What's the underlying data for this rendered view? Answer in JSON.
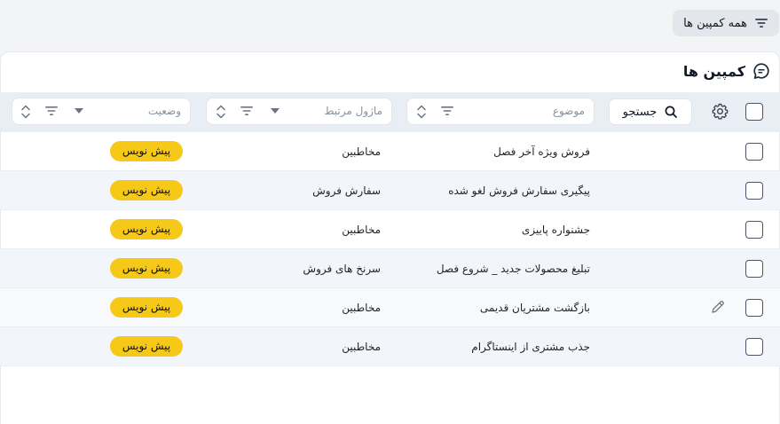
{
  "top": {
    "filter_label": "همه کمپین ها",
    "filter_icon": "filter-lines-icon"
  },
  "panel": {
    "title": "کمپین ها",
    "title_icon": "chat-bubble-icon"
  },
  "toolbar": {
    "settings_icon": "gear-icon",
    "search_label": "جستجو",
    "search_icon": "search-icon"
  },
  "columns": {
    "subject": {
      "label": "موضوع"
    },
    "module": {
      "label": "ماژول مرتبط"
    },
    "status": {
      "label": "وضعیت"
    }
  },
  "rows": [
    {
      "subject": "فروش ویژه آخر فصل",
      "module": "مخاطبین",
      "status": "پیش نویس"
    },
    {
      "subject": "پیگیری سفارش فروش لغو شده",
      "module": "سفارش فروش",
      "status": "پیش نویس"
    },
    {
      "subject": "جشنواره پاییزی",
      "module": "مخاطبین",
      "status": "پیش نویس"
    },
    {
      "subject": "تبلیغ محصولات جدید _ شروع فصل",
      "module": "سرنخ های فروش",
      "status": "پیش نویس"
    },
    {
      "subject": "بازگشت مشتریان قدیمی",
      "module": "مخاطبین",
      "status": "پیش نویس"
    },
    {
      "subject": "جذب مشتری از اینستاگرام",
      "module": "مخاطبین",
      "status": "پیش نویس"
    }
  ],
  "colors": {
    "badge": "#f6c817",
    "header_bg": "#e9eef4",
    "row_alt": "#f2f5f9"
  }
}
